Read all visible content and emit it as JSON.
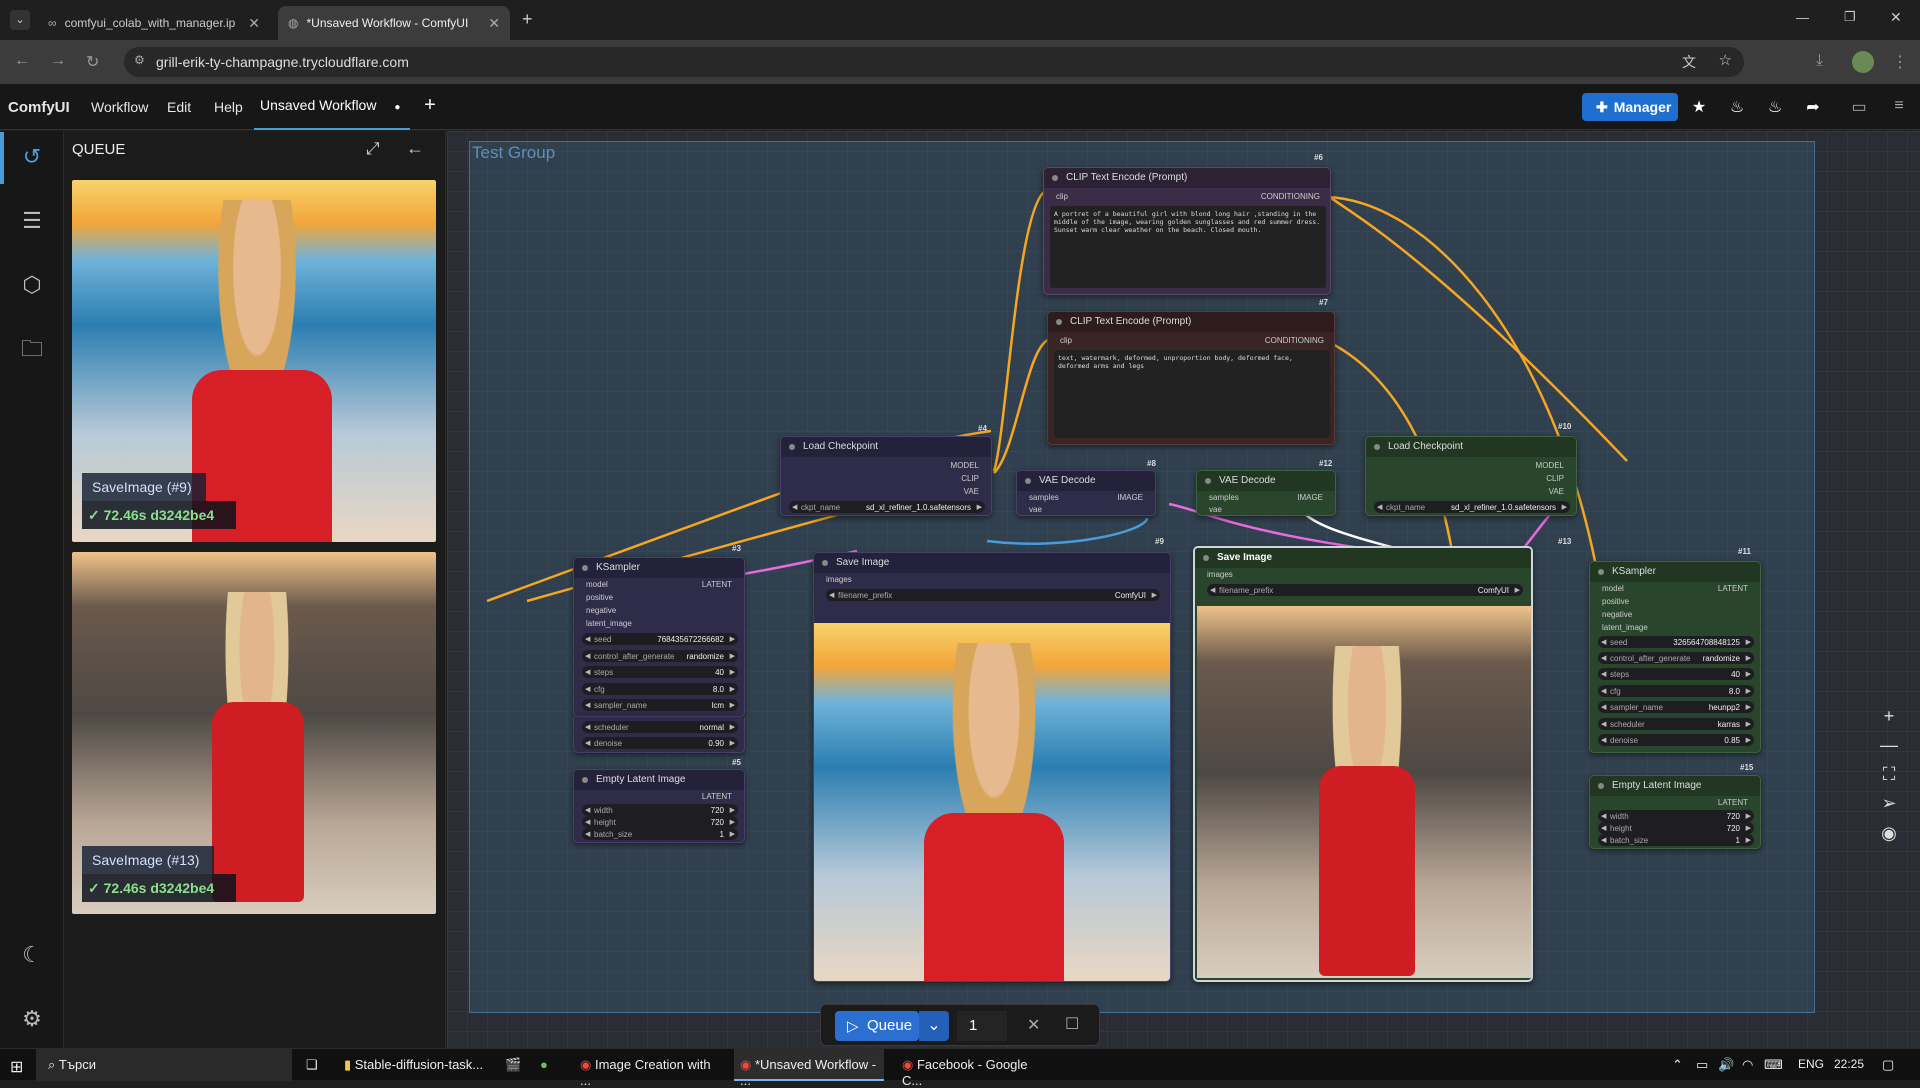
{
  "browser": {
    "tabs": [
      {
        "label": "comfyui_colab_with_manager.ip",
        "icon": "colab-icon"
      },
      {
        "label": "*Unsaved Workflow - ComfyUI",
        "icon": "globe-icon"
      }
    ],
    "url": "grill-erik-ty-champagne.trycloudflare.com"
  },
  "menu": {
    "brand": "ComfyUI",
    "items": [
      "Workflow",
      "Edit",
      "Help"
    ],
    "workflow_tab": "Unsaved Workflow",
    "manager_label": "Manager"
  },
  "queue_panel": {
    "title": "QUEUE",
    "items": [
      {
        "label": "SaveImage (#9)",
        "time": "72.46s d3242be4"
      },
      {
        "label": "SaveImage (#13)",
        "time": "72.46s d3242be4"
      }
    ]
  },
  "group": {
    "title": "Test Group"
  },
  "nodes": {
    "clip1": {
      "id": "#6",
      "title": "CLIP Text Encode (Prompt)",
      "in": "clip",
      "out": "CONDITIONING",
      "text": "A portret of a beautiful girl with blond long hair ,standing in the middle of the image, wearing golden sunglasses and red summer dress. Sunset warm clear weather on the beach. Closed mouth."
    },
    "clip2": {
      "id": "#7",
      "title": "CLIP Text Encode (Prompt)",
      "in": "clip",
      "out": "CONDITIONING",
      "text": "text, watermark, deformed, unproportion body, deformed face, deformed arms and legs"
    },
    "ckpt1": {
      "id": "#4",
      "title": "Load Checkpoint",
      "outs": [
        "MODEL",
        "CLIP",
        "VAE"
      ],
      "w_name": "ckpt_name",
      "w_val": "sd_xl_refiner_1.0.safetensors"
    },
    "ckpt2": {
      "id": "#10",
      "title": "Load Checkpoint",
      "outs": [
        "MODEL",
        "CLIP",
        "VAE"
      ],
      "w_name": "ckpt_name",
      "w_val": "sd_xl_refiner_1.0.safetensors"
    },
    "vae1": {
      "id": "#8",
      "title": "VAE Decode",
      "ins": [
        "samples",
        "vae"
      ],
      "out": "IMAGE"
    },
    "vae2": {
      "id": "#12",
      "title": "VAE Decode",
      "ins": [
        "samples",
        "vae"
      ],
      "out": "IMAGE"
    },
    "ks1": {
      "id": "#3",
      "title": "KSampler",
      "ins": [
        "model",
        "positive",
        "negative",
        "latent_image"
      ],
      "out": "LATENT",
      "widgets": [
        [
          "seed",
          "768435672266682"
        ],
        [
          "control_after_generate",
          "randomize"
        ],
        [
          "steps",
          "40"
        ],
        [
          "cfg",
          "8.0"
        ],
        [
          "sampler_name",
          "lcm"
        ],
        [
          "scheduler",
          "normal"
        ],
        [
          "denoise",
          "0.90"
        ]
      ]
    },
    "ks2": {
      "id": "#11",
      "title": "KSampler",
      "ins": [
        "model",
        "positive",
        "negative",
        "latent_image"
      ],
      "out": "LATENT",
      "widgets": [
        [
          "seed",
          "326564708848125"
        ],
        [
          "control_after_generate",
          "randomize"
        ],
        [
          "steps",
          "40"
        ],
        [
          "cfg",
          "8.0"
        ],
        [
          "sampler_name",
          "heunpp2"
        ],
        [
          "scheduler",
          "karras"
        ],
        [
          "denoise",
          "0.85"
        ]
      ]
    },
    "save1": {
      "id": "#9",
      "title": "Save Image",
      "in": "images",
      "w_name": "filename_prefix",
      "w_val": "ComfyUI"
    },
    "save2": {
      "id": "#13",
      "title": "Save Image",
      "in": "images",
      "w_name": "filename_prefix",
      "w_val": "ComfyUI"
    },
    "lat1": {
      "id": "#5",
      "title": "Empty Latent Image",
      "out": "LATENT",
      "widgets": [
        [
          "width",
          "720"
        ],
        [
          "height",
          "720"
        ],
        [
          "batch_size",
          "1"
        ]
      ]
    },
    "lat2": {
      "id": "#15",
      "title": "Empty Latent Image",
      "out": "LATENT",
      "widgets": [
        [
          "width",
          "720"
        ],
        [
          "height",
          "720"
        ],
        [
          "batch_size",
          "1"
        ]
      ]
    }
  },
  "queue_bar": {
    "label": "Queue",
    "count": "1"
  },
  "taskbar": {
    "search": "Търси",
    "apps": [
      "Stable-diffusion-task...",
      "Image Creation with ...",
      "*Unsaved Workflow - ...",
      "Facebook - Google C..."
    ],
    "lang": "ENG",
    "time": "22:25"
  },
  "colors": {
    "accent": "#1f6fd1",
    "group": "#3f6f95",
    "node_purple": "#2f2c4a",
    "node_brown": "#3a2525",
    "node_green": "#29452c"
  }
}
